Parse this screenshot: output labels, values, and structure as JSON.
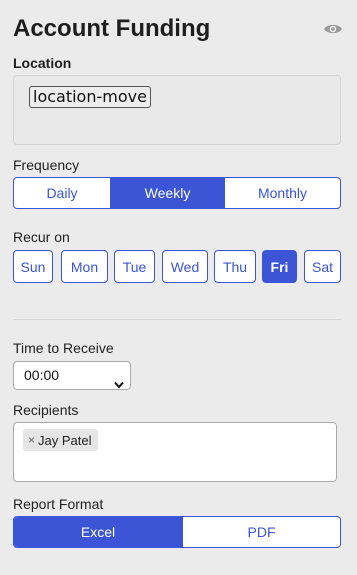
{
  "header": {
    "title": "Account Funding",
    "visibility_icon": "eye-icon"
  },
  "location": {
    "label": "Location",
    "chip_label": "location-move"
  },
  "frequency": {
    "label": "Frequency",
    "options": [
      "Daily",
      "Weekly",
      "Monthly"
    ],
    "selected": "Weekly"
  },
  "recur": {
    "label": "Recur on",
    "days": [
      "Sun",
      "Mon",
      "Tue",
      "Wed",
      "Thu",
      "Fri",
      "Sat"
    ],
    "selected": "Fri"
  },
  "time": {
    "label": "Time to Receive",
    "value": "00:00"
  },
  "recipients": {
    "label": "Recipients",
    "items": [
      {
        "name": "Jay Patel",
        "remove_symbol": "×"
      }
    ]
  },
  "report_format": {
    "label": "Report Format",
    "options": [
      "Excel",
      "PDF"
    ],
    "selected": "Excel"
  },
  "colors": {
    "accent": "#3b55d6",
    "background": "#ebebeb"
  }
}
